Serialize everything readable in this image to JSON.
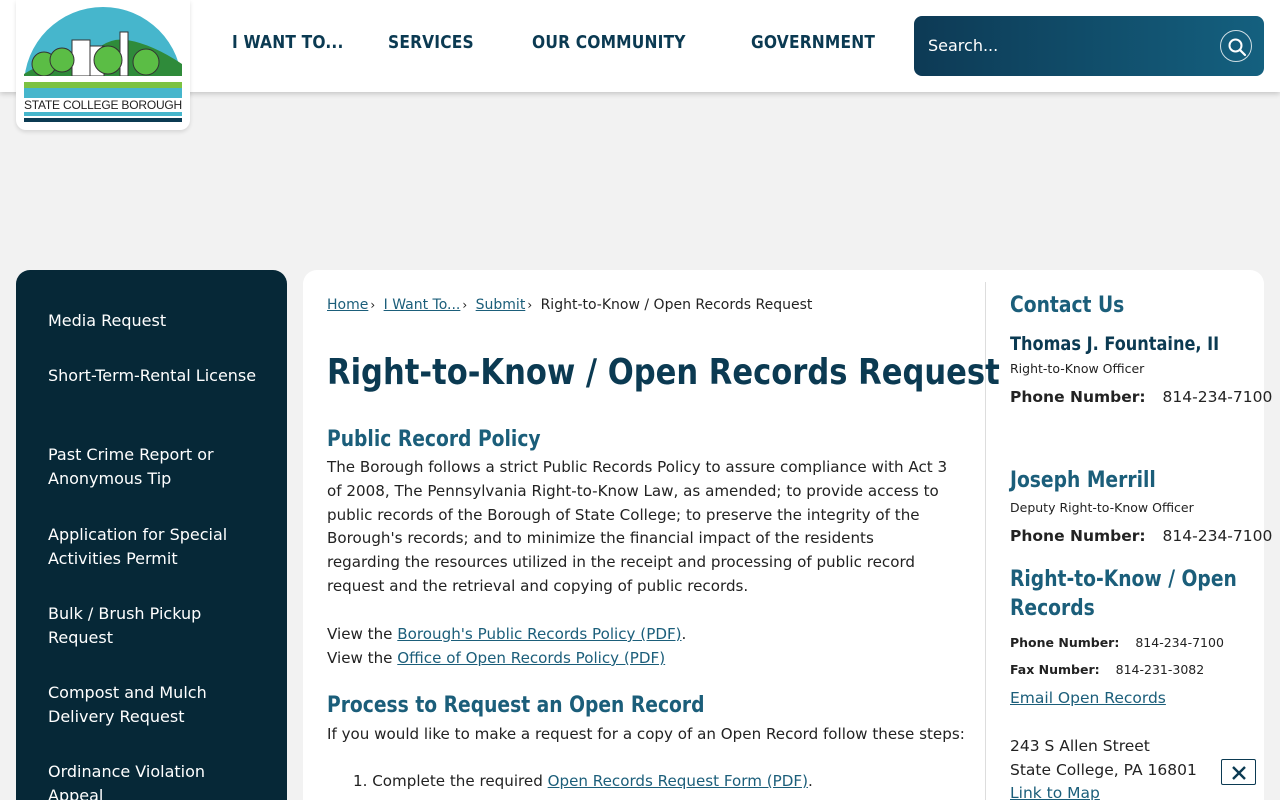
{
  "header": {
    "logo_text": "STATE COLLEGE BOROUGH",
    "nav": [
      "I WANT TO...",
      "SERVICES",
      "OUR COMMUNITY",
      "GOVERNMENT"
    ],
    "search_placeholder": "Search..."
  },
  "leftnav": [
    "Media Request",
    "Short-Term-Rental License",
    "Past Crime Report or Anonymous Tip",
    "Application for Special Activities Permit",
    "Bulk / Brush Pickup Request",
    "Compost and Mulch Delivery Request",
    "Ordinance Violation Appeal"
  ],
  "breadcrumb": {
    "items": [
      "Home",
      "I Want To...",
      "Submit"
    ],
    "current": "Right-to-Know / Open Records Request",
    "separator": "›"
  },
  "page_title": "Right-to-Know / Open Records Request",
  "policy": {
    "heading": "Public Record Policy",
    "body": "The Borough follows a strict Public Records Policy to assure compliance with Act 3 of 2008, The Pennsylvania Right-to-Know Law, as amended; to provide access to public records of the Borough of State College; to preserve the integrity of the Borough's records; and to minimize the financial impact of the residents regarding the resources utilized in the receipt and processing of public record request and the retrieval and copying of public records.",
    "view_prefix": "View the",
    "link1": "Borough's Public Records Policy (PDF)",
    "link1_suffix": ".",
    "link2": "Office of Open Records Policy (PDF)"
  },
  "process": {
    "heading": "Process to Request an Open Record",
    "intro": "If you would like to make a request for a copy of an Open Record follow these steps:",
    "step1_num": "1.",
    "step1_prefix": "Complete the required",
    "step1_link": "Open Records Request Form (PDF)",
    "step1_suffix": "."
  },
  "contact": {
    "heading": "Contact Us",
    "person1_name": "Thomas J. Fountaine, II",
    "person1_title": "Right-to-Know Officer",
    "phone_label": "Phone Number:",
    "person1_phone": "814-234-7100",
    "person2_name": "Joseph Merrill",
    "person2_title": "Deputy Right-to-Know Officer",
    "person2_phone": "814-234-7100",
    "office_heading_line1": "Right-to-Know / Open",
    "office_heading_line2": "Records",
    "office_phone": "814-234-7100",
    "fax_label": "Fax Number:",
    "office_fax": "814-231-3082",
    "email_link": "Email Open Records",
    "address1": "243 S Allen Street",
    "address2": "State College, PA 16801",
    "map_link": "Link to Map"
  },
  "colors": {
    "navy": "#062837",
    "heading": "#0b3a52",
    "link": "#1b5e7a",
    "background": "#f2f2f2"
  }
}
